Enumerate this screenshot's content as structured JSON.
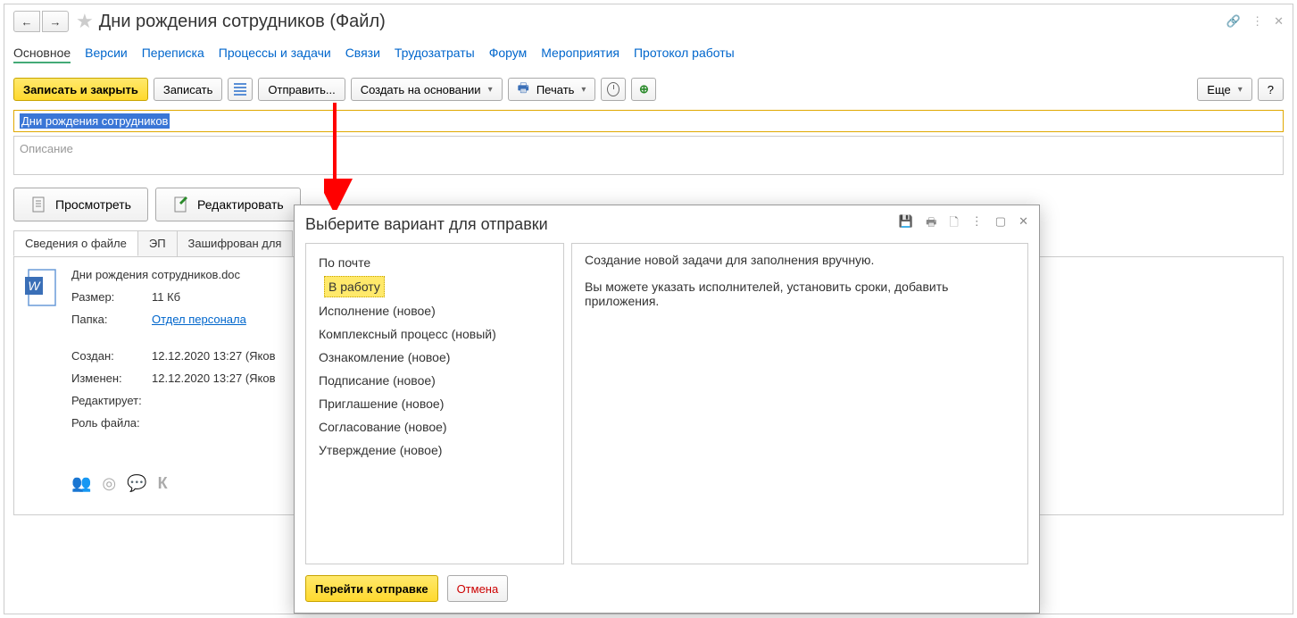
{
  "title": "Дни рождения сотрудников (Файл)",
  "nav": {
    "main": "Основное",
    "versions": "Версии",
    "correspondence": "Переписка",
    "processes": "Процессы и задачи",
    "links": "Связи",
    "labor": "Трудозатраты",
    "forum": "Форум",
    "events": "Мероприятия",
    "protocol": "Протокол работы"
  },
  "toolbar": {
    "save_close": "Записать и закрыть",
    "save": "Записать",
    "send": "Отправить...",
    "create_based": "Создать на основании",
    "print": "Печать",
    "more": "Еще",
    "help": "?"
  },
  "name_field": "Дни рождения сотрудников",
  "desc_placeholder": "Описание",
  "actions": {
    "view": "Просмотреть",
    "edit": "Редактировать"
  },
  "subtabs": {
    "info": "Сведения о файле",
    "ep": "ЭП",
    "encrypted": "Зашифрован для"
  },
  "file": {
    "filename": "Дни рождения сотрудников.doc",
    "size_label": "Размер:",
    "size_value": "11 Кб",
    "folder_label": "Папка:",
    "folder_link": "Отдел персонала",
    "created_label": "Создан:",
    "created_value": "12.12.2020 13:27 (Яков",
    "modified_label": "Изменен:",
    "modified_value": "12.12.2020 13:27 (Яков",
    "edits_label": "Редактирует:",
    "role_label": "Роль файла:"
  },
  "modal": {
    "title": "Выберите вариант для отправки",
    "options": [
      "По почте",
      "В работу",
      "Исполнение (новое)",
      "Комплексный процесс (новый)",
      "Ознакомление (новое)",
      "Подписание (новое)",
      "Приглашение (новое)",
      "Согласование (новое)",
      "Утверждение (новое)"
    ],
    "selected_index": 1,
    "desc_line1": "Создание новой задачи для заполнения вручную.",
    "desc_line2": "Вы можете указать исполнителей, установить сроки, добавить приложения.",
    "go": "Перейти к отправке",
    "cancel": "Отмена"
  },
  "bottom_letter": "К"
}
